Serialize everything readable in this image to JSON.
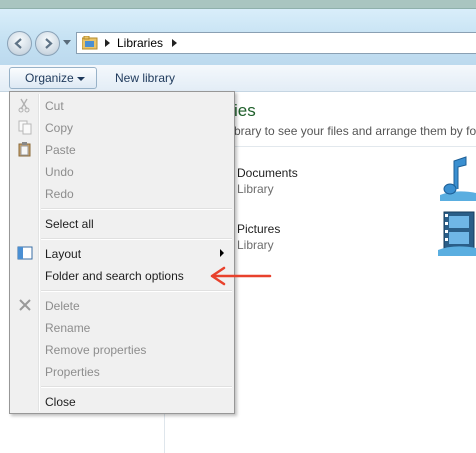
{
  "addressbar": {
    "breadcrumb": "Libraries",
    "icon": "libraries-folder-icon"
  },
  "command_bar": {
    "organize_label": "Organize",
    "new_library_label": "New library"
  },
  "content": {
    "title_fragment": "ies",
    "description_fragment": "brary to see your files and arrange them by fol",
    "libraries": [
      {
        "name": "Documents",
        "type": "Library",
        "icon": "documents-library-icon"
      },
      {
        "name": "Pictures",
        "type": "Library",
        "icon": "pictures-library-icon"
      }
    ]
  },
  "menu": {
    "items": [
      {
        "label": "Cut",
        "enabled": false,
        "icon": "scissors-icon"
      },
      {
        "label": "Copy",
        "enabled": false,
        "icon": "copy-icon"
      },
      {
        "label": "Paste",
        "enabled": false,
        "icon": "paste-icon"
      },
      {
        "label": "Undo",
        "enabled": false
      },
      {
        "label": "Redo",
        "enabled": false
      },
      {
        "label": "Select all",
        "enabled": true
      },
      {
        "label": "Layout",
        "enabled": true,
        "icon": "layout-icon",
        "has_submenu": true
      },
      {
        "label": "Folder and search options",
        "enabled": true
      },
      {
        "label": "Delete",
        "enabled": false,
        "icon": "delete-x-icon"
      },
      {
        "label": "Rename",
        "enabled": false
      },
      {
        "label": "Remove properties",
        "enabled": false
      },
      {
        "label": "Properties",
        "enabled": false
      },
      {
        "label": "Close",
        "enabled": true
      }
    ]
  },
  "annotation": {
    "color": "#e8412c",
    "points_to": "Folder and search options"
  },
  "colors": {
    "title_green": "#1e5f2a",
    "link_blue": "#1e395b",
    "disabled_gray": "#8d8d8d"
  }
}
